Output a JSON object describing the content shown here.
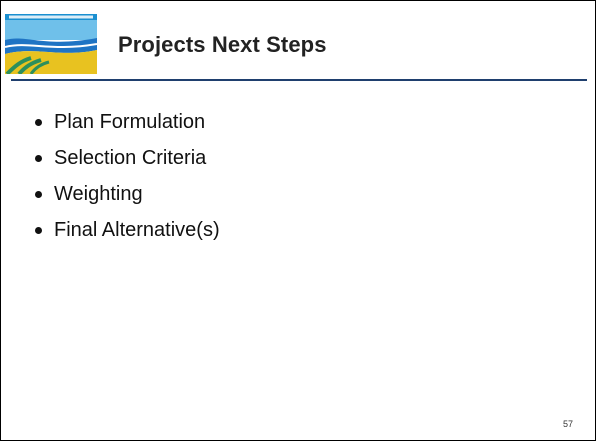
{
  "slide": {
    "title": "Projects Next Steps",
    "bullets": [
      "Plan Formulation",
      "Selection Criteria",
      "Weighting",
      "Final Alternative(s)"
    ],
    "page_number": "57"
  },
  "colors": {
    "rule": "#1f3f6e",
    "logo_blue": "#1a8fd0",
    "logo_yellow": "#e8c220",
    "logo_green": "#2c8f5c"
  },
  "icons": {
    "logo": "river-valley-logo"
  }
}
